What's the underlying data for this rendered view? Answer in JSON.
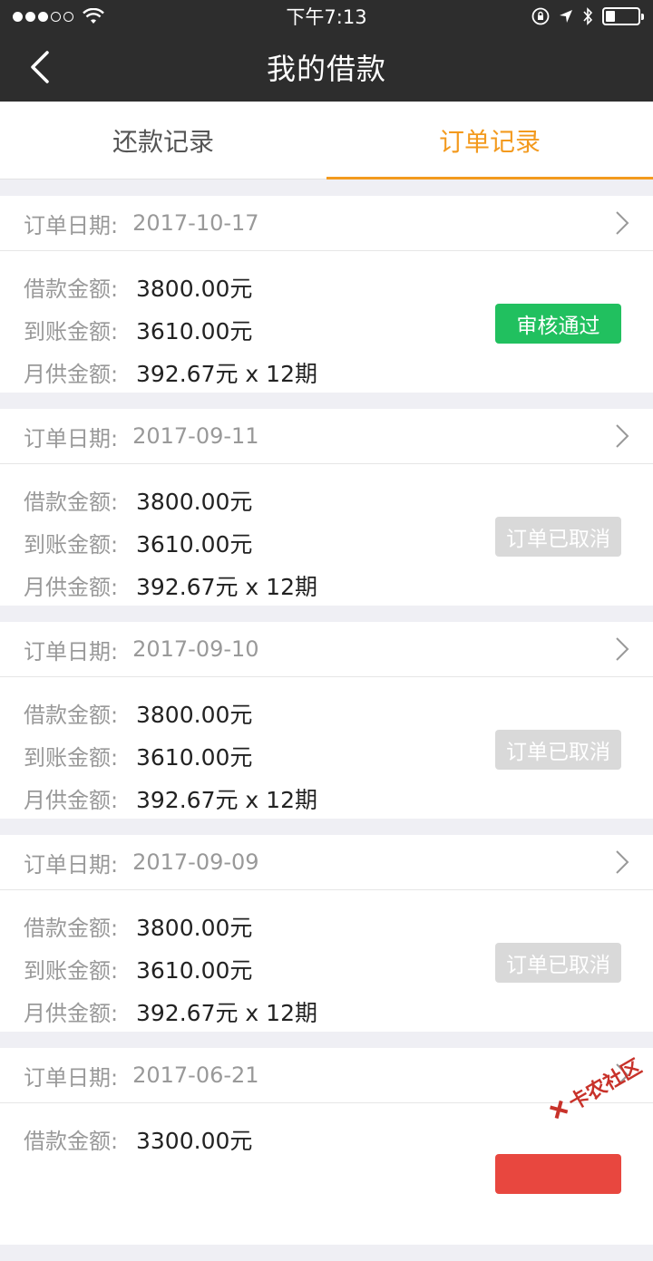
{
  "status_bar": {
    "time": "下午7:13"
  },
  "nav": {
    "title": "我的借款"
  },
  "tabs": [
    {
      "label": "还款记录",
      "active": false
    },
    {
      "label": "订单记录",
      "active": true
    }
  ],
  "labels": {
    "order_date": "订单日期:",
    "loan_amount": "借款金额:",
    "arrival_amount": "到账金额:",
    "monthly_amount": "月供金额:"
  },
  "orders": [
    {
      "date": "2017-10-17",
      "loan": "3800.00元",
      "arrival": "3610.00元",
      "monthly": "392.67元 x 12期",
      "status": "审核通过",
      "status_type": "approved"
    },
    {
      "date": "2017-09-11",
      "loan": "3800.00元",
      "arrival": "3610.00元",
      "monthly": "392.67元 x 12期",
      "status": "订单已取消",
      "status_type": "cancelled"
    },
    {
      "date": "2017-09-10",
      "loan": "3800.00元",
      "arrival": "3610.00元",
      "monthly": "392.67元 x 12期",
      "status": "订单已取消",
      "status_type": "cancelled"
    },
    {
      "date": "2017-09-09",
      "loan": "3800.00元",
      "arrival": "3610.00元",
      "monthly": "392.67元 x 12期",
      "status": "订单已取消",
      "status_type": "cancelled"
    },
    {
      "date": "2017-06-21",
      "loan": "3300.00元",
      "arrival": "",
      "monthly": "",
      "status": "",
      "status_type": "red"
    }
  ],
  "watermark": {
    "text": "卡农社区"
  },
  "colors": {
    "accent": "#f39a1e",
    "approved": "#21c05f",
    "cancelled": "#d9d9d9",
    "navbar": "#2d2d2d"
  }
}
